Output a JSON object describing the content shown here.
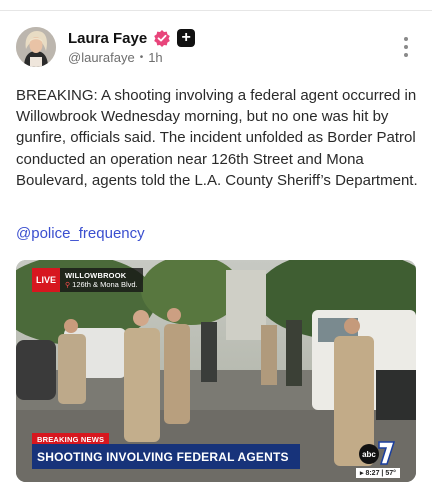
{
  "user": {
    "display_name": "Laura Faye",
    "handle": "@laurafaye",
    "time_ago": "1h",
    "verified": true,
    "avatar_icon": "avatar-photo"
  },
  "post": {
    "text": "BREAKING: A shooting involving a federal agent occurred in Willowbrook Wednesday morning, but no one was hit by gunfire, officials said. The incident unfolded as Border Patrol conducted an operation near 126th Street and Mona Boulevard, agents told the L.A. County Sheriff’s Department.",
    "mention": "@police_frequency"
  },
  "media": {
    "live_label": "LIVE",
    "location_city": "WILLOWBROOK",
    "location_street": "126th & Mona Blvd.",
    "breaking_label": "BREAKING NEWS",
    "headline": "SHOOTING INVOLVING FEDERAL AGENTS",
    "network_logo": "abc7",
    "logo_text": "abc",
    "time_temp": "▸ 8:27 | 57°"
  },
  "colors": {
    "accent_link": "#3b4fcf",
    "live_red": "#d7171f",
    "headline_blue": "#17337a",
    "verified_pink": "#e8457b"
  },
  "icons": [
    "verified-badge-icon",
    "plus-icon",
    "more-options-icon",
    "location-pin-icon",
    "abc7-logo-icon"
  ]
}
